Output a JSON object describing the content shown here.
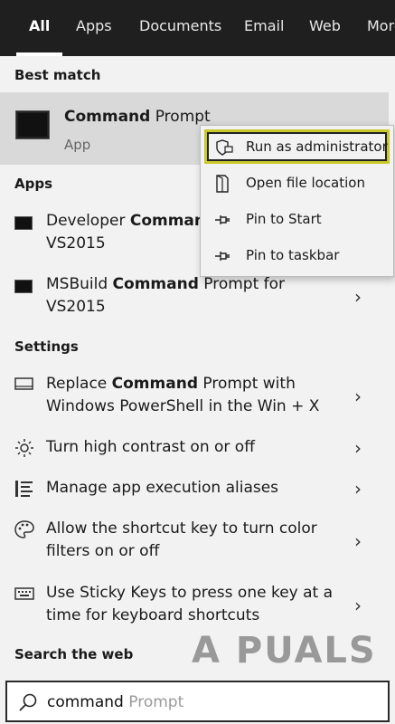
{
  "tabs": [
    {
      "label": "All",
      "active": true
    },
    {
      "label": "Apps"
    },
    {
      "label": "Documents"
    },
    {
      "label": "Email"
    },
    {
      "label": "Web"
    },
    {
      "label": "More"
    }
  ],
  "sections": {
    "best_match": "Best match",
    "apps": "Apps",
    "settings": "Settings",
    "web": "Search the web"
  },
  "best_match": {
    "title_bold": "Command",
    "title_rest": " Prompt",
    "subtitle": "App",
    "icon": "command-prompt-icon"
  },
  "apps": [
    {
      "pre": "Developer ",
      "bold": "Command",
      "post": "",
      "line2": "VS2015",
      "icon": "command-prompt-icon"
    },
    {
      "pre": "MSBuild ",
      "bold": "Command",
      "post": " Prompt for",
      "line2": "VS2015",
      "icon": "command-prompt-icon"
    }
  ],
  "settings": [
    {
      "pre": "Replace ",
      "bold": "Command",
      "post": " Prompt with",
      "line2": "Windows PowerShell in the Win + X",
      "icon": "monitor-icon"
    },
    {
      "pre": "Turn high contrast on or off",
      "bold": "",
      "post": "",
      "line2": "",
      "icon": "brightness-icon"
    },
    {
      "pre": "Manage app execution aliases",
      "bold": "",
      "post": "",
      "line2": "",
      "icon": "list-icon"
    },
    {
      "pre": "Allow the shortcut key to turn color",
      "bold": "",
      "post": "",
      "line2": "filters on or off",
      "icon": "palette-icon"
    },
    {
      "pre": "Use Sticky Keys to press one key at a",
      "bold": "",
      "post": "",
      "line2": "time for keyboard shortcuts",
      "icon": "keyboard-icon"
    }
  ],
  "context_menu": [
    {
      "label": "Run as administrator",
      "icon": "shield-icon"
    },
    {
      "label": "Open file location",
      "icon": "file-location-icon"
    },
    {
      "label": "Pin to Start",
      "icon": "pin-icon"
    },
    {
      "label": "Pin to taskbar",
      "icon": "pin-icon"
    }
  ],
  "search": {
    "typed": "command",
    "suggestion": " Prompt"
  },
  "watermark": "A PUALS",
  "colors": {
    "tab_bar": "#1f1f1f",
    "highlight_border": "#c8c82a",
    "selected_row": "#d9d9d9"
  }
}
